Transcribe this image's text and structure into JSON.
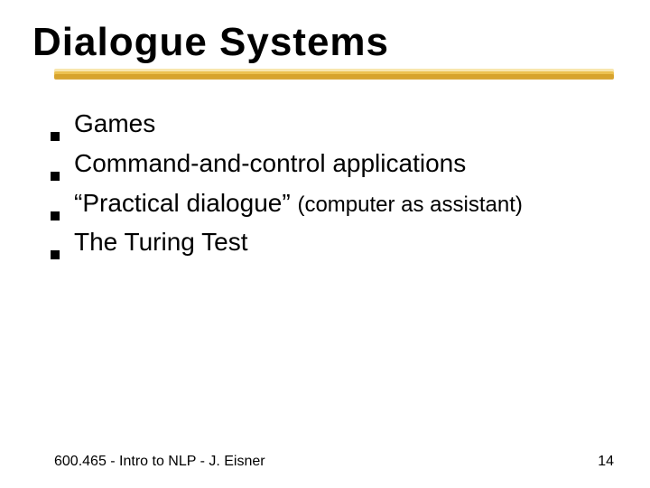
{
  "title": "Dialogue Systems",
  "bullets": [
    {
      "text": "Games",
      "paren": ""
    },
    {
      "text": "Command-and-control applications",
      "paren": ""
    },
    {
      "text": "“Practical dialogue” ",
      "paren": "(computer as assistant)"
    },
    {
      "text": "The Turing Test",
      "paren": ""
    }
  ],
  "footer": {
    "left": "600.465 - Intro to NLP - J. Eisner",
    "page": "14"
  }
}
